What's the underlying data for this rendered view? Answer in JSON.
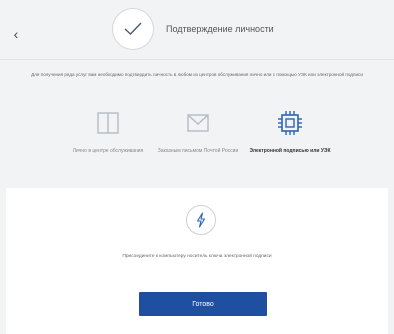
{
  "nav": {
    "back_glyph": "‹"
  },
  "header": {
    "title": "Подтверждение личности"
  },
  "description": "Для получения ряда услуг вам необходимо подтвердить личность в любом из центров обслуживания лично или с помощью УЭК или электронной подписи",
  "options": [
    {
      "label": "Лично в центре обслуживания",
      "icon": "book-icon",
      "active": false
    },
    {
      "label": "Заказным письмом Почтой России",
      "icon": "envelope-icon",
      "active": false
    },
    {
      "label": "Электронной подписью или УЭК",
      "icon": "chip-icon",
      "active": true
    }
  ],
  "panel": {
    "hint": "Присоедините к компьютеру носитель ключа электронной подписи",
    "done_label": "Готово"
  },
  "colors": {
    "accent": "#1f4fa0",
    "icon_gray": "#b5bbc3",
    "active_icon": "#2c63b8"
  }
}
